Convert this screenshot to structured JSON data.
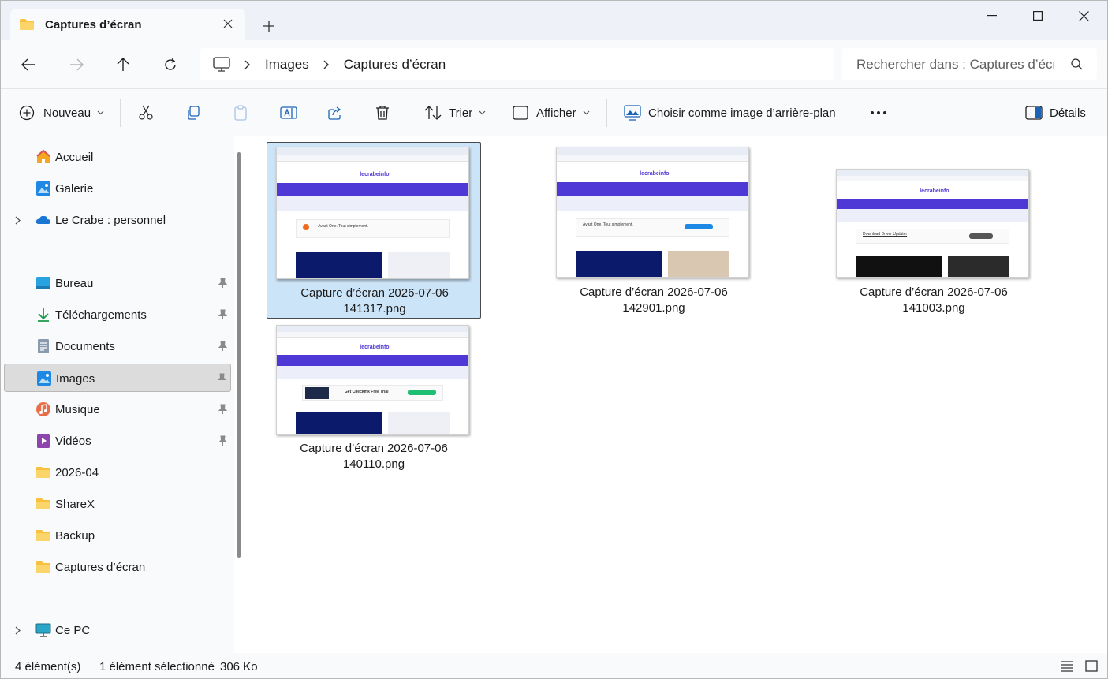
{
  "tab": {
    "title": "Captures d’écran"
  },
  "nav": {
    "breadcrumbs": [
      "Images",
      "Captures d’écran"
    ],
    "search_placeholder": "Rechercher dans : Captures d’écran"
  },
  "commands": {
    "new_label": "Nouveau",
    "sort_label": "Trier",
    "view_label": "Afficher",
    "wallpaper_label": "Choisir comme image d’arrière-plan",
    "details_label": "Détails"
  },
  "sidebar": {
    "items": [
      {
        "label": "Accueil",
        "icon": "home-icon"
      },
      {
        "label": "Galerie",
        "icon": "gallery-icon"
      },
      {
        "label": "Le Crabe : personnel",
        "icon": "onedrive-cloud-icon"
      },
      {
        "label": "Bureau",
        "icon": "desktop-icon",
        "pinned": true
      },
      {
        "label": "Téléchargements",
        "icon": "download-icon",
        "pinned": true
      },
      {
        "label": "Documents",
        "icon": "documents-icon",
        "pinned": true
      },
      {
        "label": "Images",
        "icon": "pictures-icon",
        "pinned": true,
        "selected": true
      },
      {
        "label": "Musique",
        "icon": "music-icon",
        "pinned": true
      },
      {
        "label": "Vidéos",
        "icon": "videos-icon",
        "pinned": true
      },
      {
        "label": "2026-04",
        "icon": "folder-icon"
      },
      {
        "label": "ShareX",
        "icon": "folder-icon"
      },
      {
        "label": "Backup",
        "icon": "folder-icon"
      },
      {
        "label": "Captures d’écran",
        "icon": "folder-icon"
      },
      {
        "label": "Ce PC",
        "icon": "this-pc-icon"
      }
    ]
  },
  "files": [
    {
      "line1": "Capture d’écran 2026-07-06",
      "line2": "141317.png",
      "selected": true,
      "thumb_logo": "lecrabeinfo",
      "ad_text": "Avast One. Tout simplement."
    },
    {
      "line1": "Capture d’écran 2026-07-06",
      "line2": "142901.png",
      "selected": false,
      "thumb_logo": "lecrabeinfo",
      "ad_text": "Avast One. Tout simplement."
    },
    {
      "line1": "Capture d’écran 2026-07-06",
      "line2": "141003.png",
      "selected": false,
      "thumb_logo": "lecrabeinfo",
      "ad_text": "Download Driver Updater"
    },
    {
      "line1": "Capture d’écran 2026-07-06",
      "line2": "140110.png",
      "selected": false,
      "thumb_logo": "lecrabeinfo",
      "ad_text": "Get Checkmk Free Trial"
    }
  ],
  "status": {
    "count": "4 élément(s)",
    "selection": "1 élément sélectionné",
    "size": "306 Ko"
  },
  "colors": {
    "accent": "#0067c0",
    "selection_bg": "#cce4f7",
    "thumb_nav": "#4f39d6"
  }
}
